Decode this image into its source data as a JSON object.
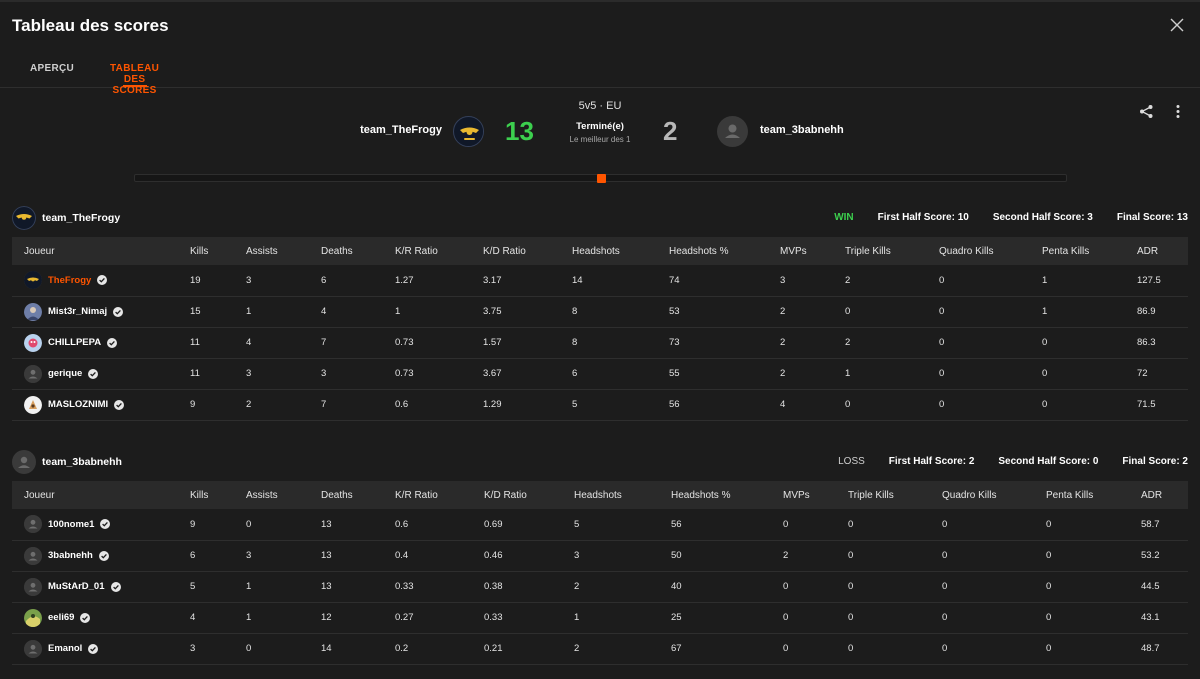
{
  "modal": {
    "title": "Tableau des scores",
    "tabs": [
      {
        "label": "APERÇU",
        "active": false
      },
      {
        "label": "TABLEAU DES SCORES",
        "active": true
      }
    ]
  },
  "match": {
    "mode": "5v5 · EU",
    "status": "Terminé(e)",
    "best_of": "Le meilleur des 1",
    "team_a": {
      "name": "team_TheFrogy",
      "score": "13",
      "color": "#3ccf4e"
    },
    "team_b": {
      "name": "team_3babnehh",
      "score": "2",
      "color": "#b8b8b8"
    },
    "accent": "#ff5500"
  },
  "columns": [
    "Joueur",
    "Kills",
    "Assists",
    "Deaths",
    "K/R Ratio",
    "K/D Ratio",
    "Headshots",
    "Headshots %",
    "MVPs",
    "Triple Kills",
    "Quadro Kills",
    "Penta Kills",
    "ADR"
  ],
  "teams": [
    {
      "name": "team_TheFrogy",
      "result": "WIN",
      "first_half": "First Half Score: 10",
      "second_half": "Second Half Score: 3",
      "final": "Final Score: 13",
      "players": [
        {
          "name": "TheFrogy",
          "highlight": true,
          "avatar": "frog",
          "stats": [
            "19",
            "3",
            "6",
            "1.27",
            "3.17",
            "14",
            "74",
            "3",
            "2",
            "0",
            "1",
            "127.5"
          ]
        },
        {
          "name": "Mist3r_Nimaj",
          "highlight": false,
          "avatar": "mist",
          "stats": [
            "15",
            "1",
            "4",
            "1",
            "3.75",
            "8",
            "53",
            "2",
            "0",
            "0",
            "1",
            "86.9"
          ]
        },
        {
          "name": "CHILLPEPA",
          "highlight": false,
          "avatar": "pepa",
          "stats": [
            "11",
            "4",
            "7",
            "0.73",
            "1.57",
            "8",
            "73",
            "2",
            "2",
            "0",
            "0",
            "86.3"
          ]
        },
        {
          "name": "gerique",
          "highlight": false,
          "avatar": "default",
          "stats": [
            "11",
            "3",
            "3",
            "0.73",
            "3.67",
            "6",
            "55",
            "2",
            "1",
            "0",
            "0",
            "72"
          ]
        },
        {
          "name": "MASLOZNIMI",
          "highlight": false,
          "avatar": "maslo",
          "stats": [
            "9",
            "2",
            "7",
            "0.6",
            "1.29",
            "5",
            "56",
            "4",
            "0",
            "0",
            "0",
            "71.5"
          ]
        }
      ]
    },
    {
      "name": "team_3babnehh",
      "result": "LOSS",
      "first_half": "First Half Score: 2",
      "second_half": "Second Half Score: 0",
      "final": "Final Score: 2",
      "players": [
        {
          "name": "100nome1",
          "highlight": false,
          "avatar": "default",
          "stats": [
            "9",
            "0",
            "13",
            "0.6",
            "0.69",
            "5",
            "56",
            "0",
            "0",
            "0",
            "0",
            "58.7"
          ]
        },
        {
          "name": "3babnehh",
          "highlight": false,
          "avatar": "default",
          "stats": [
            "6",
            "3",
            "13",
            "0.4",
            "0.46",
            "3",
            "50",
            "2",
            "0",
            "0",
            "0",
            "53.2"
          ]
        },
        {
          "name": "MuStArD_01",
          "highlight": false,
          "avatar": "default",
          "stats": [
            "5",
            "1",
            "13",
            "0.33",
            "0.38",
            "2",
            "40",
            "0",
            "0",
            "0",
            "0",
            "44.5"
          ]
        },
        {
          "name": "eeli69",
          "highlight": false,
          "avatar": "eeli",
          "stats": [
            "4",
            "1",
            "12",
            "0.27",
            "0.33",
            "1",
            "25",
            "0",
            "0",
            "0",
            "0",
            "43.1"
          ]
        },
        {
          "name": "Emanol",
          "highlight": false,
          "avatar": "default",
          "stats": [
            "3",
            "0",
            "14",
            "0.2",
            "0.21",
            "2",
            "67",
            "0",
            "0",
            "0",
            "0",
            "48.7"
          ]
        }
      ]
    }
  ]
}
